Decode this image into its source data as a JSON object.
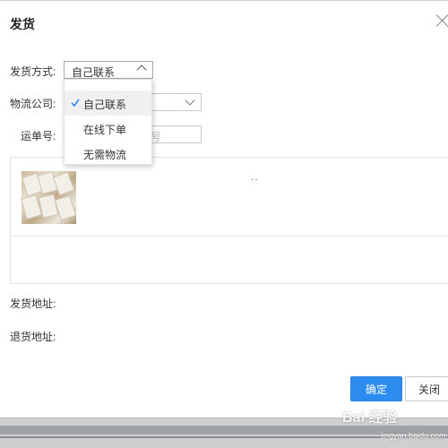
{
  "dialog": {
    "title": "发货"
  },
  "form": {
    "shipping_method": {
      "label": "发货方式:",
      "value": "自己联系"
    },
    "logistics_company": {
      "label": "物流公司:"
    },
    "tracking_number": {
      "label": "运单号:",
      "placeholder_fragment": "号"
    },
    "ship_from_address": {
      "label": "发货地址:"
    },
    "return_address": {
      "label": "退货地址:"
    }
  },
  "dropdown": {
    "options": [
      {
        "label": "自己联系",
        "selected": true
      },
      {
        "label": "在线下单",
        "selected": false
      },
      {
        "label": "无需物流",
        "selected": false
      }
    ]
  },
  "product": {
    "note": ".."
  },
  "buttons": {
    "confirm": "确定",
    "close": "关闭"
  },
  "watermark": {
    "text": "Bai 经验",
    "sub": "jingyan.baidu.com"
  },
  "colors": {
    "primary": "#2d8cf0",
    "check": "#2d8cf0"
  }
}
